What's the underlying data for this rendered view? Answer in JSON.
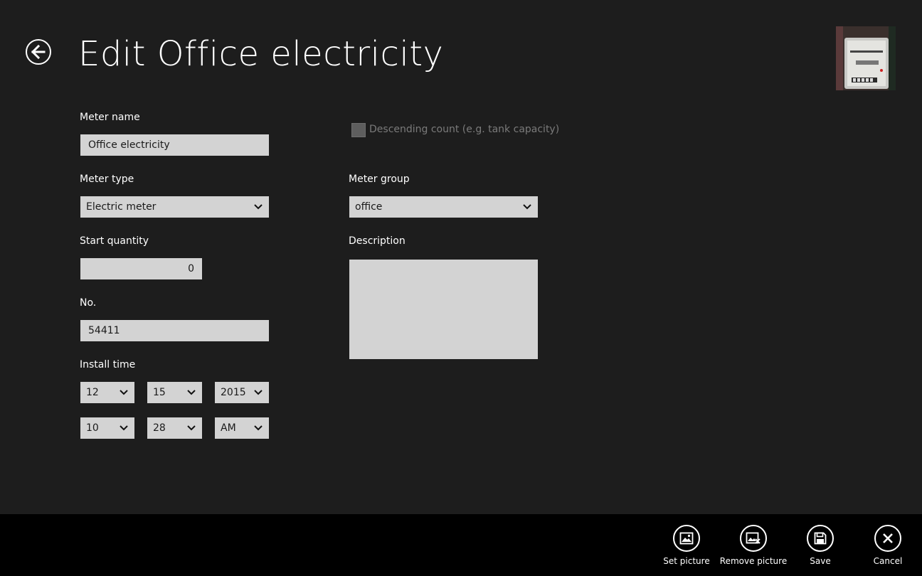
{
  "header": {
    "title": "Edit Office electricity"
  },
  "form": {
    "meter_name": {
      "label": "Meter name",
      "value": "Office electricity"
    },
    "meter_type": {
      "label": "Meter type",
      "value": "Electric meter"
    },
    "start_quantity": {
      "label": "Start quantity",
      "value": "0"
    },
    "number": {
      "label": "No.",
      "value": "54411"
    },
    "install_time": {
      "label": "Install time",
      "month": "12",
      "day": "15",
      "year": "2015",
      "hour": "10",
      "minute": "28",
      "ampm": "AM"
    },
    "descending": {
      "label": "Descending count (e.g. tank capacity)",
      "checked": false
    },
    "meter_group": {
      "label": "Meter group",
      "value": "office"
    },
    "description": {
      "label": "Description",
      "value": ""
    }
  },
  "appbar": {
    "set_picture": "Set picture",
    "remove_picture": "Remove picture",
    "save": "Save",
    "cancel": "Cancel"
  },
  "icons": {
    "back": "back-arrow-icon",
    "set_picture": "picture-icon",
    "remove_picture": "remove-picture-icon",
    "save": "save-icon",
    "cancel": "close-icon"
  },
  "colors": {
    "background": "#1d1d1d",
    "appbar": "#000000",
    "field": "#d3d3d3",
    "disabled_text": "#7a7a7a"
  }
}
